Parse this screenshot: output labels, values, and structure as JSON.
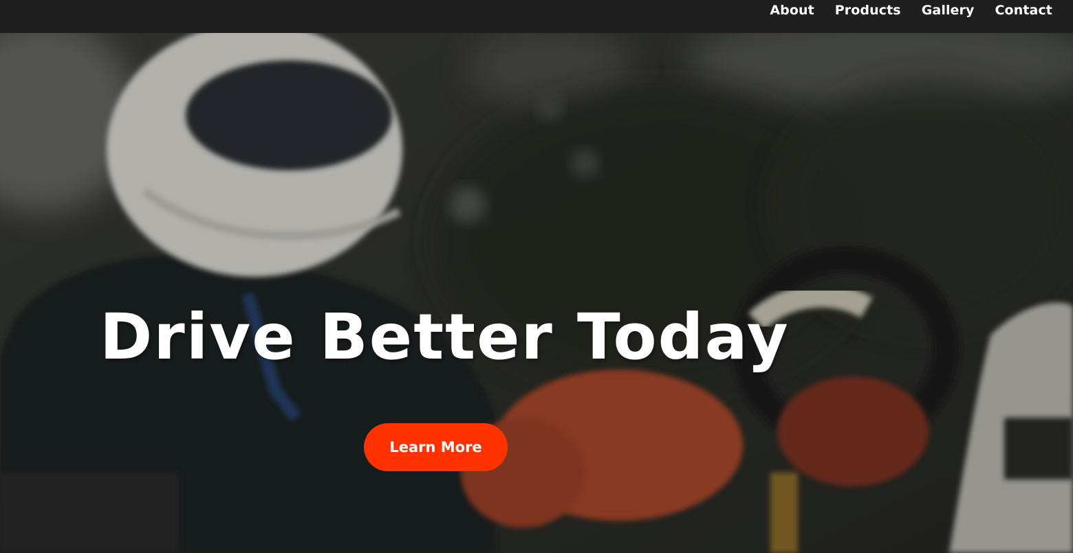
{
  "nav": {
    "items": [
      {
        "label": "About"
      },
      {
        "label": "Products"
      },
      {
        "label": "Gallery"
      },
      {
        "label": "Contact"
      }
    ]
  },
  "hero": {
    "title": "Drive Better Today",
    "cta_label": "Learn More",
    "background": "photo of a go-kart driver in a white helmet and orange gloves gripping the steering wheel",
    "accent_color": "#ff3300"
  }
}
